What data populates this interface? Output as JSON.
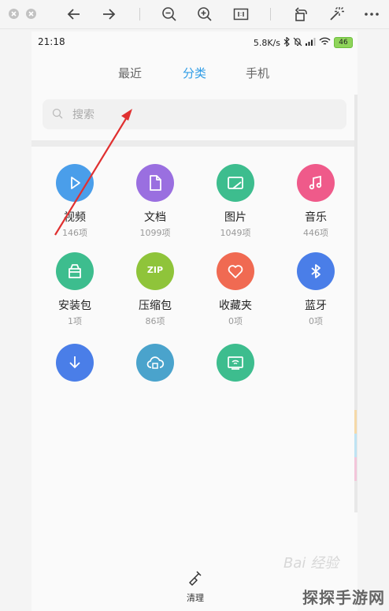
{
  "status_bar": {
    "time": "21:18",
    "speed": "5.8K/s",
    "battery": "46"
  },
  "tabs": [
    {
      "label": "最近"
    },
    {
      "label": "分类"
    },
    {
      "label": "手机"
    }
  ],
  "search": {
    "placeholder": "搜索"
  },
  "categories": [
    {
      "name": "视频",
      "count": "146项",
      "color": "#4a9eea",
      "icon": "play-icon"
    },
    {
      "name": "文档",
      "count": "1099项",
      "color": "#9a6fe0",
      "icon": "document-icon"
    },
    {
      "name": "图片",
      "count": "1049项",
      "color": "#3dbd8e",
      "icon": "picture-icon"
    },
    {
      "name": "音乐",
      "count": "446项",
      "color": "#ef5a8a",
      "icon": "music-icon"
    },
    {
      "name": "安装包",
      "count": "1项",
      "color": "#3dbd8e",
      "icon": "package-icon"
    },
    {
      "name": "压缩包",
      "count": "86项",
      "color": "#8fc43a",
      "icon": "zip-icon",
      "icon_text": "ZIP"
    },
    {
      "name": "收藏夹",
      "count": "0项",
      "color": "#f06a52",
      "icon": "heart-icon"
    },
    {
      "name": "蓝牙",
      "count": "0项",
      "color": "#4a7ee8",
      "icon": "bluetooth-icon"
    },
    {
      "name": "",
      "count": "",
      "color": "#4a7ee8",
      "icon": "download-icon"
    },
    {
      "name": "",
      "count": "",
      "color": "#4aa3cc",
      "icon": "cloud-icon"
    },
    {
      "name": "",
      "count": "",
      "color": "#3dbd8e",
      "icon": "wifi-transfer-icon"
    }
  ],
  "bottom": {
    "clean_label": "清理"
  },
  "watermark": {
    "site": "探探手游网",
    "baidu": "Bai 经验"
  }
}
